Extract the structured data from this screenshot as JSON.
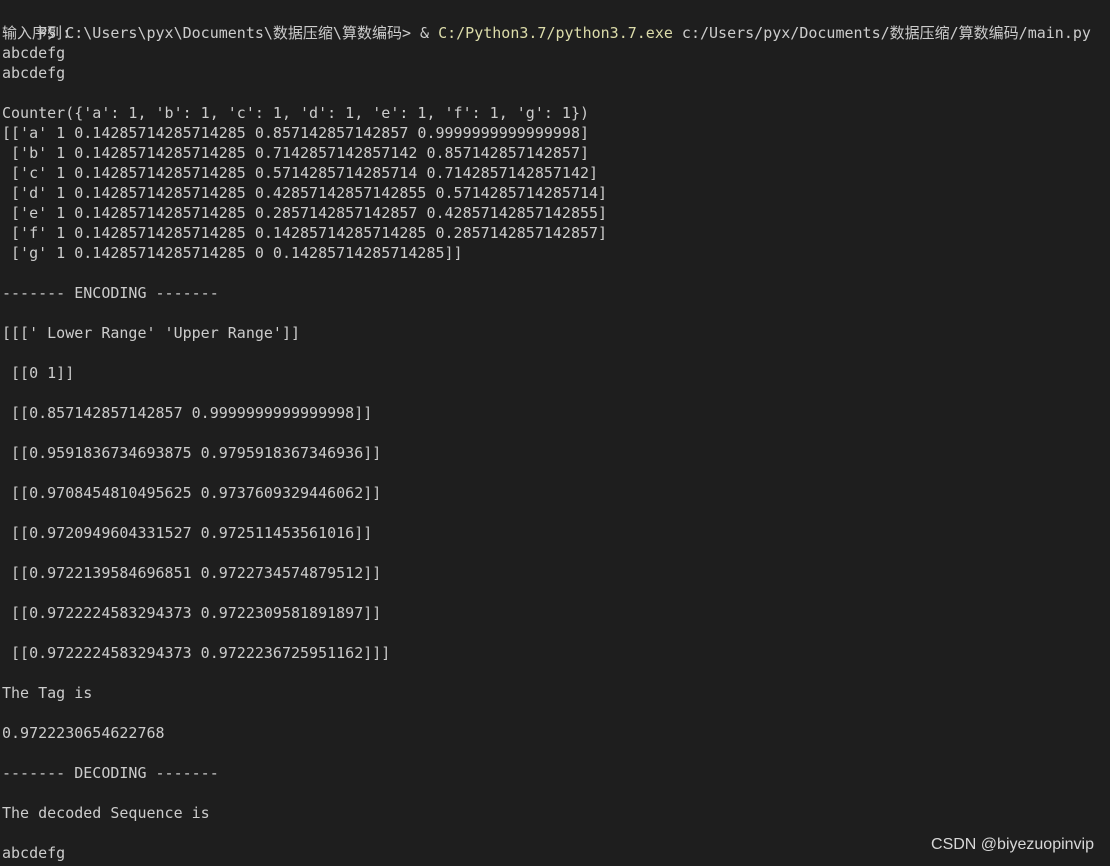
{
  "terminal": {
    "prompt": {
      "ps": "PS C:\\Users\\pyx\\Documents\\数据压缩\\算数编码> & ",
      "exe": "C:/Python3.7/python3.7.exe",
      "args": " c:/Users/pyx/Documents/数据压缩/算数编码/main.py"
    },
    "lines": [
      "输入序列:",
      "abcdefg",
      "abcdefg",
      "",
      "Counter({'a': 1, 'b': 1, 'c': 1, 'd': 1, 'e': 1, 'f': 1, 'g': 1})",
      "[['a' 1 0.14285714285714285 0.857142857142857 0.9999999999999998]",
      " ['b' 1 0.14285714285714285 0.7142857142857142 0.857142857142857]",
      " ['c' 1 0.14285714285714285 0.5714285714285714 0.7142857142857142]",
      " ['d' 1 0.14285714285714285 0.42857142857142855 0.5714285714285714]",
      " ['e' 1 0.14285714285714285 0.2857142857142857 0.42857142857142855]",
      " ['f' 1 0.14285714285714285 0.14285714285714285 0.2857142857142857]",
      " ['g' 1 0.14285714285714285 0 0.14285714285714285]]",
      "",
      "------- ENCODING -------",
      "",
      "[[[' Lower Range' 'Upper Range']]",
      "",
      " [[0 1]]",
      "",
      " [[0.857142857142857 0.9999999999999998]]",
      "",
      " [[0.9591836734693875 0.9795918367346936]]",
      "",
      " [[0.9708454810495625 0.9737609329446062]]",
      "",
      " [[0.9720949604331527 0.972511453561016]]",
      "",
      " [[0.9722139584696851 0.9722734574879512]]",
      "",
      " [[0.9722224583294373 0.9722309581891897]]",
      "",
      " [[0.9722224583294373 0.9722236725951162]]]",
      "",
      "The Tag is",
      "",
      "0.9722230654622768",
      "",
      "------- DECODING -------",
      "",
      "The decoded Sequence is",
      "",
      "abcdefg"
    ]
  },
  "watermark": "CSDN @biyezuopinvip",
  "colors": {
    "background": "#1e1e1e",
    "text": "#cccccc",
    "executable": "#dcdcaa"
  }
}
